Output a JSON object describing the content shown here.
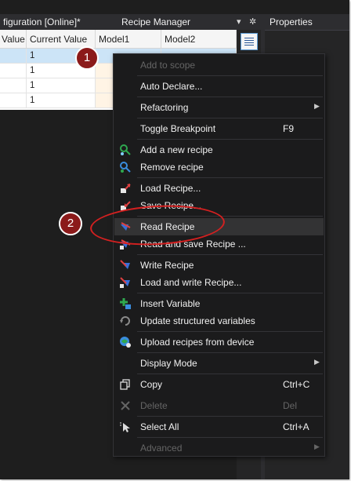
{
  "window": {
    "tab_title": "figuration [Online]*",
    "panel_title": "Recipe Manager",
    "properties_title": "Properties",
    "dropdown_icon": "▾",
    "gear_icon": "✲"
  },
  "grid": {
    "columns": [
      "Value",
      "Current Value",
      "Model1",
      "Model2"
    ],
    "rows": [
      {
        "value": "",
        "current": "1"
      },
      {
        "value": "",
        "current": "1"
      },
      {
        "value": "",
        "current": "1"
      },
      {
        "value": "",
        "current": "1"
      }
    ]
  },
  "menu": {
    "add_to_scope": "Add to scope",
    "auto_declare": "Auto Declare...",
    "refactoring": "Refactoring",
    "toggle_breakpoint": "Toggle Breakpoint",
    "toggle_breakpoint_shortcut": "F9",
    "add_recipe": "Add a new recipe",
    "remove_recipe": "Remove recipe",
    "load_recipe": "Load Recipe...",
    "save_recipe": "Save Recipe...",
    "read_recipe": "Read Recipe",
    "read_save_recipe": "Read and save Recipe ...",
    "write_recipe": "Write Recipe",
    "load_write_recipe": "Load and write Recipe...",
    "insert_variable": "Insert Variable",
    "update_structured": "Update structured variables",
    "upload_recipes": "Upload recipes from device",
    "display_mode": "Display Mode",
    "copy": "Copy",
    "copy_shortcut": "Ctrl+C",
    "delete": "Delete",
    "delete_shortcut": "Del",
    "select_all": "Select All",
    "select_all_shortcut": "Ctrl+A",
    "advanced": "Advanced",
    "submenu_arrow": "▶"
  },
  "annotations": {
    "step1": "1",
    "step2": "2"
  },
  "colors": {
    "menu_background": "#1b1b1c",
    "highlight": "#333334",
    "annotation_red": "#d42020",
    "badge": "#8b1a1a",
    "selected_row": "#cce4f7"
  }
}
